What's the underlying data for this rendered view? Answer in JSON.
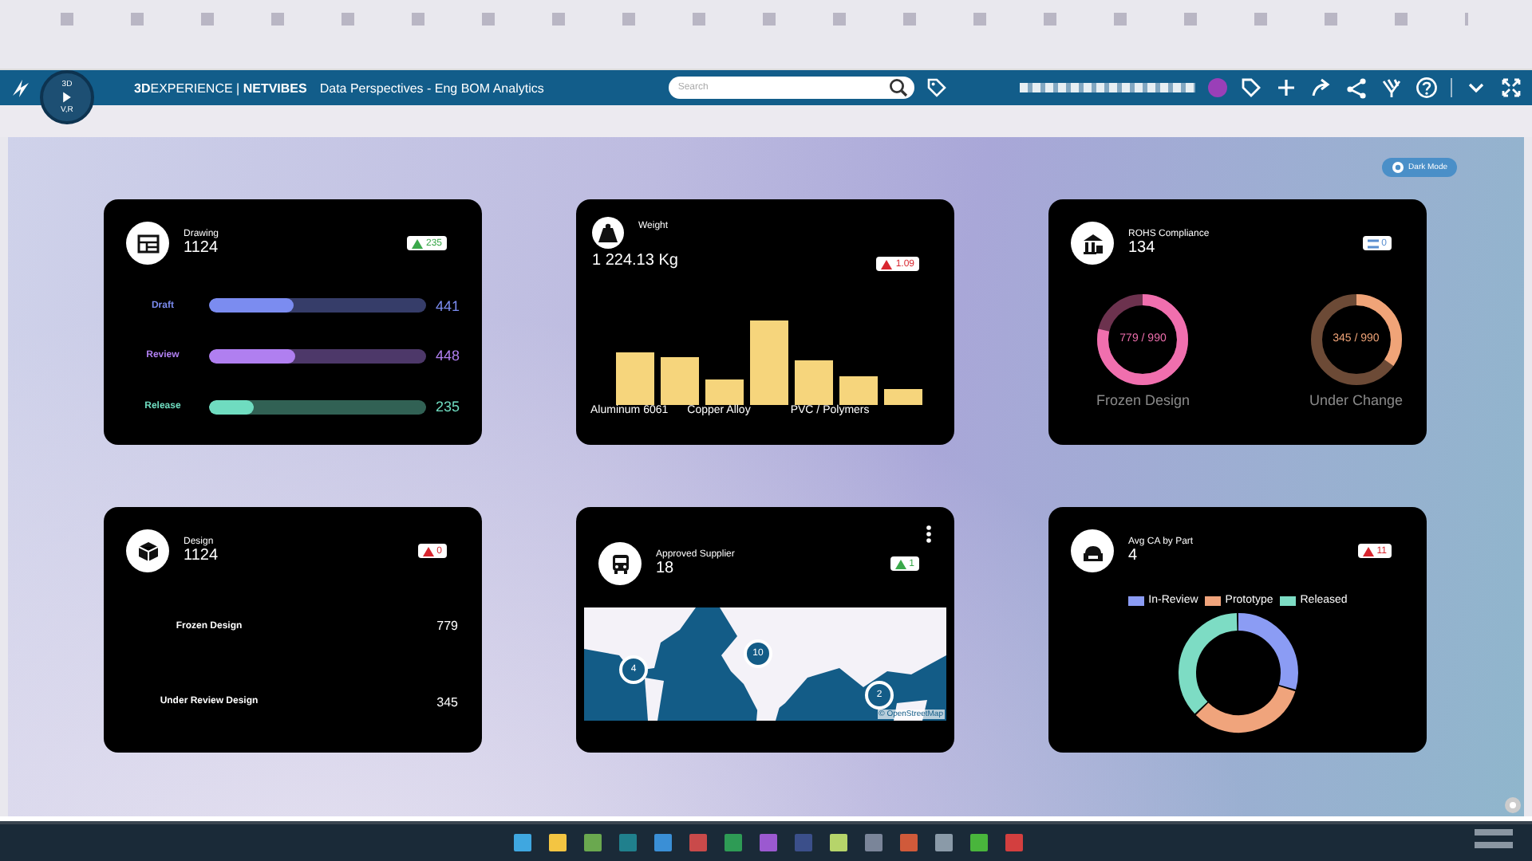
{
  "header": {
    "compass": {
      "top": "3D",
      "bottom": "V,R"
    },
    "brand": "**3D**EXPERIENCE | **NETVIBES**",
    "app_title": "Data Perspectives - Eng BOM Analytics",
    "search": {
      "placeholder": "Search"
    }
  },
  "dark_mode_button": "Dark Mode",
  "cards": [
    {
      "kind": "bars",
      "title": "Drawing",
      "value": "1124",
      "badge": {
        "text": "235",
        "kind": "up",
        "color": "#3aa84a"
      },
      "rows": [
        {
          "label": "Draft",
          "value": "441",
          "level": 0.39,
          "color": "#7b8cf0"
        },
        {
          "label": "Review",
          "value": "448",
          "level": 0.4,
          "color": "#b07ff0"
        },
        {
          "label": "Release",
          "value": "235",
          "level": 0.21,
          "color": "#6fdcc0"
        }
      ]
    },
    {
      "kind": "columns",
      "title": "Weight",
      "value": "1 224.13 Kg",
      "badge": {
        "text": "1.09",
        "kind": "up",
        "color": "#d8262f"
      },
      "labels": [
        "Aluminum 6061",
        "Copper Alloy",
        "PVC / Polymers"
      ]
    },
    {
      "kind": "rings",
      "title": "ROHS Compliance",
      "value": "134",
      "badge": {
        "text": "0",
        "kind": "flat",
        "color": "#5a8fd0"
      },
      "rings": [
        {
          "reading": "779 / 990",
          "label": "Frozen Design",
          "level": 0.787,
          "color": "#f06fae"
        },
        {
          "reading": "345 / 990",
          "label": "Under Change",
          "level": 0.348,
          "color": "#f0a478"
        }
      ]
    },
    {
      "kind": "list",
      "title": "Design",
      "value": "1124",
      "badge": {
        "text": "0",
        "kind": "up",
        "color": "#d8262f"
      },
      "rows": [
        {
          "label": "Frozen Design",
          "value": "779"
        },
        {
          "label": "Under Review Design",
          "value": "345"
        }
      ]
    },
    {
      "kind": "map",
      "title": "Approved Supplier",
      "value": "18",
      "badge": {
        "text": "1",
        "kind": "up",
        "color": "#3aa84a"
      },
      "markers": [
        "4",
        "10",
        "2"
      ],
      "attribution": "© OpenStreetMap"
    },
    {
      "kind": "donut",
      "title": "Avg CA by Part",
      "value": "4",
      "badge": {
        "text": "11",
        "kind": "up",
        "color": "#d8262f"
      },
      "legend": [
        {
          "label": "In-Review",
          "color": "#8b9cf4"
        },
        {
          "label": "Prototype",
          "color": "#f0a47c"
        },
        {
          "label": "Released",
          "color": "#7ddcc4"
        }
      ]
    }
  ]
}
